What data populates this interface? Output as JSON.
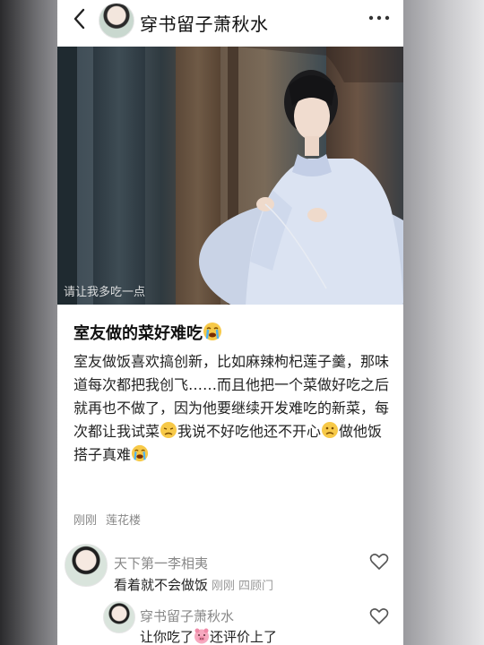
{
  "header": {
    "title": "穿书留子萧秋水",
    "back_icon": "chevron-left-icon",
    "more_icon": "more-horizontal-icon"
  },
  "photo": {
    "caption": "请让我多吃一点"
  },
  "post": {
    "title": "室友做的菜好难吃",
    "title_emoji": "crying-face",
    "body_1": "室友做饭喜欢搞创新，比如麻辣枸杞莲子羹，那味道每次都把我创飞……而且他把一个菜做好吃之后就再也不做了，因为他要继续开发难吃的新菜，每次都让我试菜",
    "body_2": "我说不好吃他还不开心",
    "body_3": "做他饭搭子真难",
    "emoji_1": "disappointed-face",
    "emoji_2": "slightly-frowning-face",
    "emoji_3": "crying-face",
    "time": "刚刚",
    "location": "莲花楼"
  },
  "comments": [
    {
      "author": "天下第一李相夷",
      "text": "看着就不会做饭",
      "time": "刚刚",
      "location": "四顾门"
    },
    {
      "author": "穿书留子萧秋水",
      "text_1": "让你吃了",
      "text_2": "还评价上了",
      "emoji": "pig-face"
    }
  ],
  "colors": {
    "text": "#222222",
    "secondary": "#888888",
    "background": "#ffffff"
  }
}
